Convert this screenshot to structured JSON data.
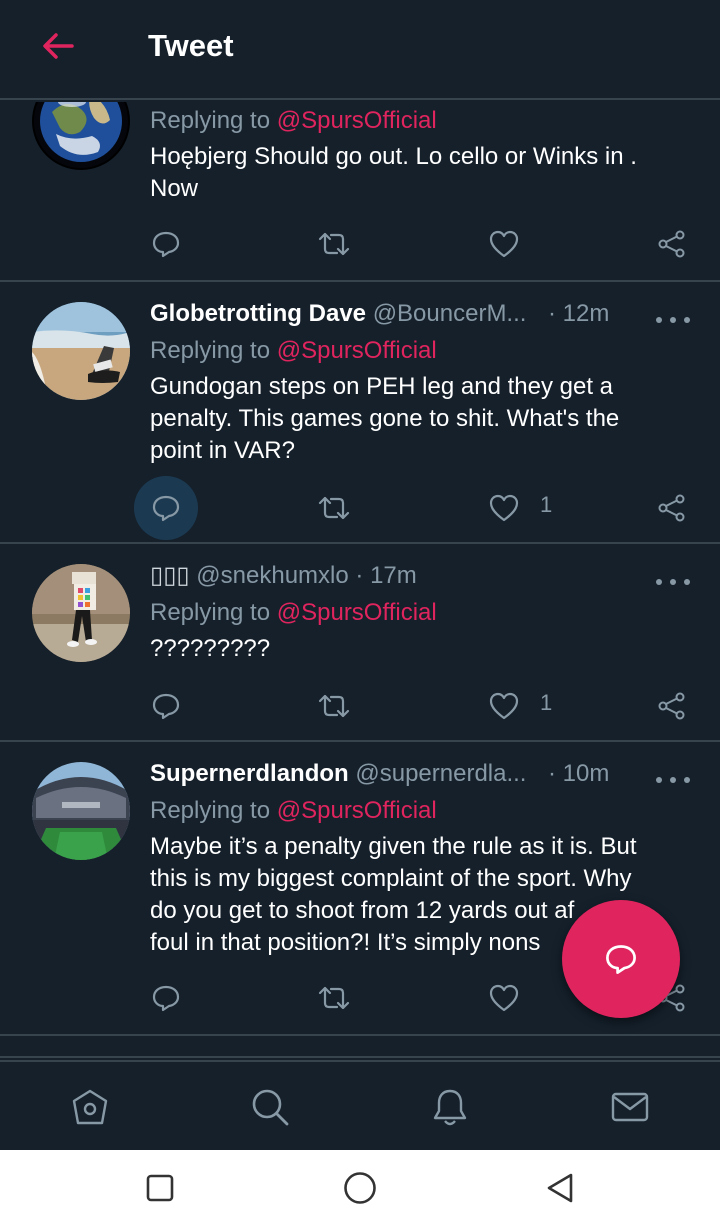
{
  "header": {
    "title": "Tweet",
    "back_icon": "arrow-left-icon",
    "accent": "#e0245e"
  },
  "colors": {
    "background": "#15202b",
    "divider": "#38444d",
    "muted": "#8899a6",
    "accent": "#e0245e"
  },
  "tweets": [
    {
      "name": "",
      "handle": "",
      "time": "",
      "replying_label": "Replying to",
      "mention": "@SpursOfficial",
      "body": [
        "Hoębjerg Should go  out. Lo cello or Winks in .",
        "Now"
      ],
      "likes": ""
    },
    {
      "name": "Globetrotting Dave",
      "handle": "@BouncerM...",
      "time": "· 12m",
      "replying_label": "Replying to",
      "mention": "@SpursOfficial",
      "body": [
        "Gundogan steps on PEH leg and they get a",
        "penalty.  This games gone to shit. What's the",
        "point in VAR?"
      ],
      "likes": "1"
    },
    {
      "name": "▯▯▯",
      "handle": "@snekhumxlo",
      "time": "· 17m",
      "replying_label": "Replying to",
      "mention": "@SpursOfficial",
      "body": [
        "?????????"
      ],
      "likes": "1"
    },
    {
      "name": "Supernerdlandon",
      "handle": "@supernerdla...",
      "time": "· 10m",
      "replying_label": "Replying to",
      "mention": "@SpursOfficial",
      "body": [
        "Maybe it’s a penalty given the rule as it is. But",
        "this is my biggest complaint of the sport. Why",
        "do you get to shoot from 12 yards out af",
        "foul in that position?! It’s simply nons"
      ],
      "likes": ""
    }
  ],
  "tabs": [
    "home-icon",
    "search-icon",
    "bell-icon",
    "mail-icon"
  ],
  "system_nav": [
    "recents-square-icon",
    "home-circle-icon",
    "back-triangle-icon"
  ]
}
